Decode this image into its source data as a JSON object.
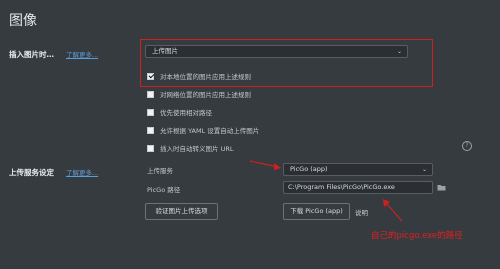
{
  "section_title": "图像",
  "insert": {
    "label": "插入图片时…",
    "learn_more": "了解更多...",
    "action_select": "上传图片",
    "options": [
      {
        "label": "对本地位置的图片应用上述规则",
        "checked": true
      },
      {
        "label": "对网络位置的图片应用上述规则",
        "checked": false
      },
      {
        "label": "优先使用相对路径",
        "checked": false
      },
      {
        "label": "允许根据 YAML 设置自动上传图片",
        "checked": false
      },
      {
        "label": "插入时自动转义图片 URL",
        "checked": false
      }
    ]
  },
  "upload_service": {
    "label": "上传服务设定",
    "learn_more": "了解更多...",
    "service_label": "上传服务",
    "service_value": "PicGo (app)",
    "path_label": "PicGo 路径",
    "path_value": "C:\\Program Files\\PicGo\\PicGo.exe",
    "verify_button": "验证图片上传选项",
    "download_button": "下载 PicGo (app)",
    "help_link": "说明"
  },
  "annotation": "自己的picgo.exe的路径",
  "colors": {
    "annotation_red": "#d11f1f",
    "link_blue": "#5e9cd8",
    "background": "#363b40"
  }
}
